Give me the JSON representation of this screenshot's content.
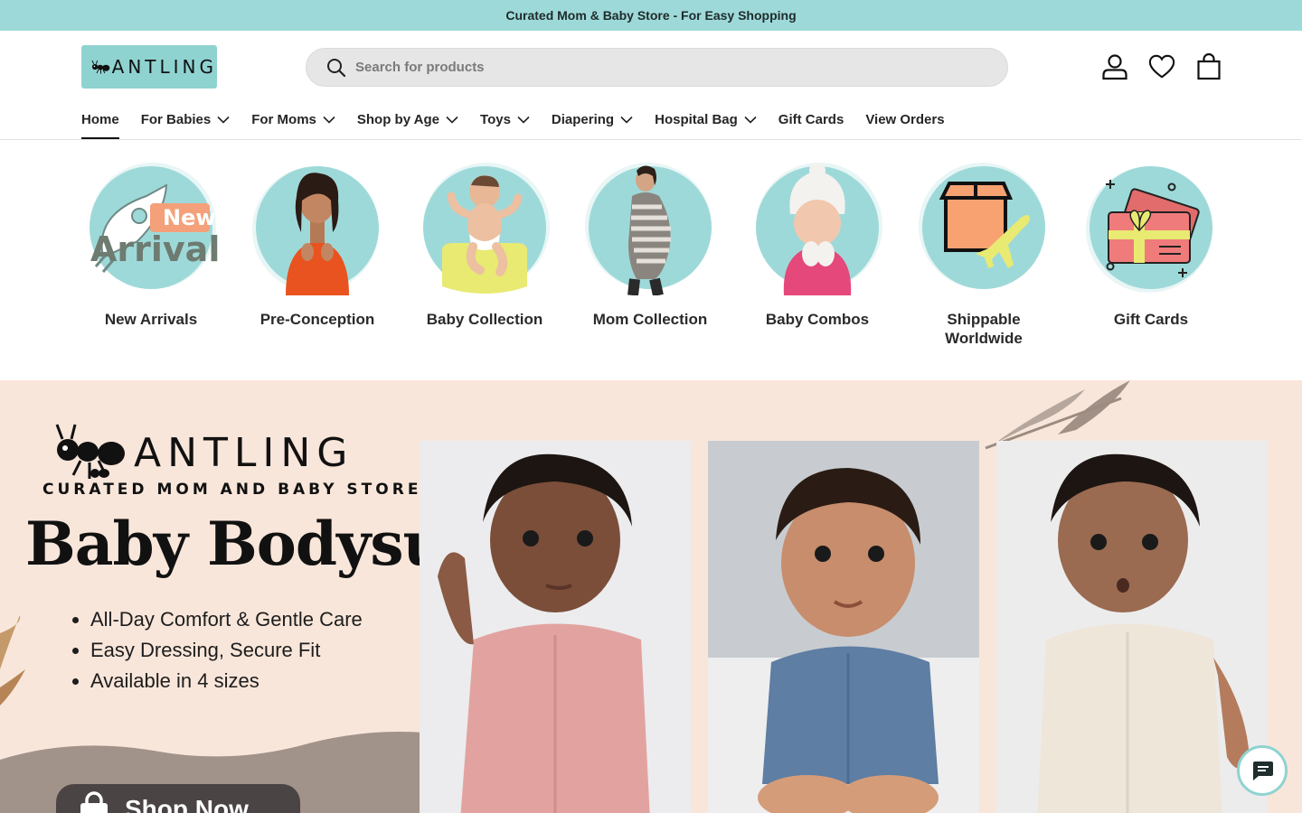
{
  "announcement": {
    "text": "Curated Mom & Baby Store - For Easy Shopping"
  },
  "header": {
    "logo_text": "ANTLING",
    "search": {
      "placeholder": "Search for products",
      "value": ""
    },
    "icons": [
      "account-icon",
      "wishlist-heart-icon",
      "cart-bag-icon"
    ]
  },
  "nav": {
    "items": [
      {
        "label": "Home",
        "active": true,
        "dropdown": false
      },
      {
        "label": "For Babies",
        "dropdown": true
      },
      {
        "label": "For Moms",
        "dropdown": true
      },
      {
        "label": "Shop by Age",
        "dropdown": true
      },
      {
        "label": "Toys",
        "dropdown": true
      },
      {
        "label": "Diapering",
        "dropdown": true
      },
      {
        "label": "Hospital Bag",
        "dropdown": true
      },
      {
        "label": "Gift Cards",
        "dropdown": false
      },
      {
        "label": "View Orders",
        "dropdown": false
      }
    ]
  },
  "categories": [
    {
      "label": "New Arrivals",
      "badge_line1": "New",
      "badge_line2": "Arrival"
    },
    {
      "label": "Pre-Conception"
    },
    {
      "label": "Baby Collection"
    },
    {
      "label": "Mom Collection"
    },
    {
      "label": "Baby Combos"
    },
    {
      "label": "Shippable Worldwide"
    },
    {
      "label": "Gift Cards"
    }
  ],
  "hero": {
    "brand": "ANTLING",
    "tagline": "CURATED MOM AND BABY STORE",
    "title": "Baby Bodysuit",
    "bullets": [
      "All-Day Comfort & Gentle Care",
      "Easy Dressing, Secure Fit",
      "Available in 4 sizes"
    ],
    "cta": "Shop Now"
  },
  "colors": {
    "accent": "#9ed9d9",
    "hero_bg": "#f9e6da",
    "text": "#1f1f1f"
  }
}
